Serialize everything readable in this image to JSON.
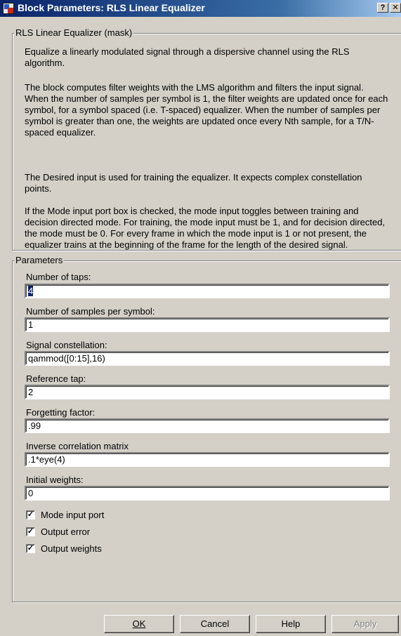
{
  "window": {
    "title": "Block Parameters: RLS Linear  Equalizer",
    "help_glyph": "?",
    "close_glyph": "✕"
  },
  "description_group": {
    "legend": "RLS Linear Equalizer (mask)",
    "paragraphs": [
      "Equalize a linearly modulated signal through a dispersive channel using the RLS algorithm.",
      "The block computes filter weights with the LMS algorithm and filters the input signal. When the number of samples per symbol is 1, the filter weights are updated once for each symbol, for a symbol spaced (i.e. T-spaced) equalizer. When the number of samples per symbol is greater than one, the weights are updated once every Nth sample, for a T/N-spaced equalizer.",
      "The Desired input is used for training the equalizer. It expects complex constellation points.",
      "If the Mode input port box is checked, the mode input toggles between training and decision directed mode. For training, the mode input must be 1, and for decision directed, the mode must be 0. For every frame in which the mode input is 1 or not present, the equalizer trains at the beginning of the frame for the length of the desired signal."
    ]
  },
  "parameters_group": {
    "legend": "Parameters",
    "fields": [
      {
        "label": "Number of taps:",
        "value": "4"
      },
      {
        "label": "Number of samples per symbol:",
        "value": "1"
      },
      {
        "label": "Signal constellation:",
        "value": "qammod([0:15],16)"
      },
      {
        "label": "Reference tap:",
        "value": "2"
      },
      {
        "label": "Forgetting factor:",
        "value": ".99"
      },
      {
        "label": "Inverse correlation matrix",
        "value": ".1*eye(4)"
      },
      {
        "label": "Initial weights:",
        "value": "0"
      }
    ],
    "checkboxes": [
      {
        "label": "Mode input port",
        "checked": true
      },
      {
        "label": "Output error",
        "checked": true
      },
      {
        "label": "Output weights",
        "checked": true
      }
    ],
    "check_glyph": "✓"
  },
  "buttons": {
    "ok": "OK",
    "cancel": "Cancel",
    "help": "Help",
    "apply": "Apply"
  },
  "colors": {
    "titlebar_start": "#0a246a",
    "titlebar_end": "#a6caf0",
    "dialog_face": "#d4d0c8",
    "selection": "#0a246a"
  }
}
